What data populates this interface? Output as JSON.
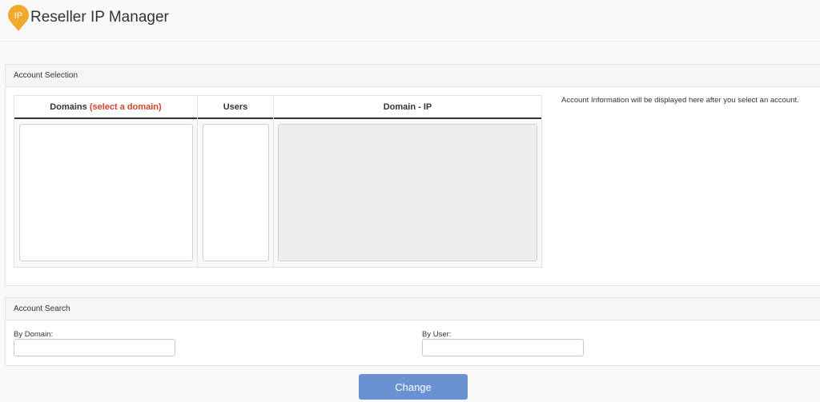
{
  "header": {
    "logo_text": "IP",
    "title": "Reseller IP Manager"
  },
  "account_selection": {
    "heading": "Account Selection",
    "columns": {
      "domains_label": "Domains",
      "domains_hint": "(select a domain)",
      "users_label": "Users",
      "domain_ip_label": "Domain - IP"
    },
    "info_text": "Account Information will be displayed here after you select an account."
  },
  "account_search": {
    "heading": "Account Search",
    "by_domain_label": "By Domain:",
    "by_user_label": "By User:",
    "by_domain_value": "",
    "by_user_value": ""
  },
  "actions": {
    "change_label": "Change"
  },
  "colors": {
    "accent": "#6a92d3",
    "hint": "#d4432a",
    "logo": "#f0a92e"
  }
}
